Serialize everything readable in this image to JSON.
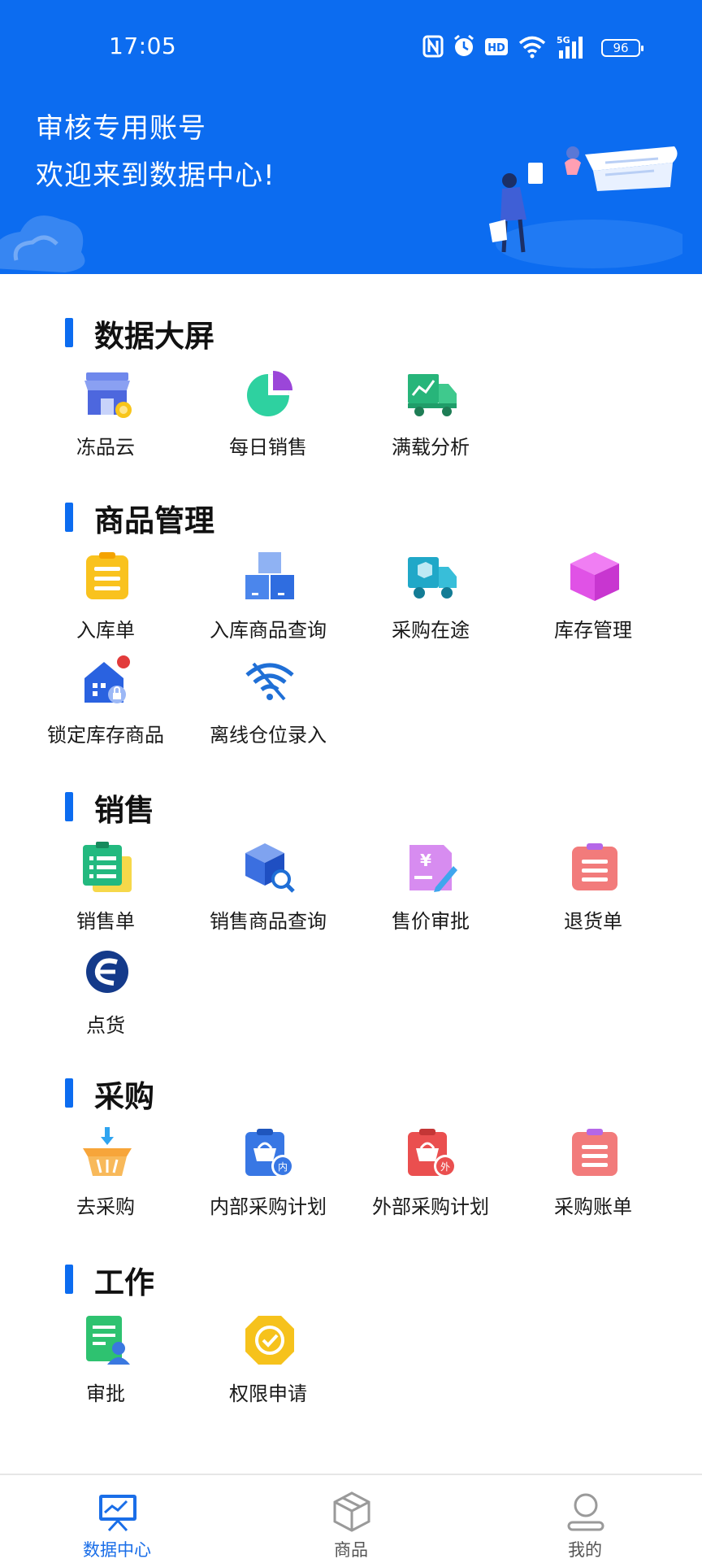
{
  "status_bar": {
    "time": "17:05",
    "battery": "96"
  },
  "header": {
    "line1": "审核专用账号",
    "line2": "欢迎来到数据中心!"
  },
  "sections": [
    {
      "title": "数据大屏",
      "items": [
        {
          "label": "冻品云",
          "icon": "store-icon"
        },
        {
          "label": "每日销售",
          "icon": "pie-chart-icon"
        },
        {
          "label": "满载分析",
          "icon": "truck-chart-icon"
        }
      ]
    },
    {
      "title": "商品管理",
      "items": [
        {
          "label": "入库单",
          "icon": "clipboard-icon"
        },
        {
          "label": "入库商品查询",
          "icon": "boxes-icon"
        },
        {
          "label": "采购在途",
          "icon": "delivery-truck-icon"
        },
        {
          "label": "库存管理",
          "icon": "cube-icon"
        },
        {
          "label": "锁定库存商品",
          "icon": "locked-warehouse-icon"
        },
        {
          "label": "离线仓位录入",
          "icon": "wifi-off-icon"
        }
      ]
    },
    {
      "title": "销售",
      "items": [
        {
          "label": "销售单",
          "icon": "sales-list-icon"
        },
        {
          "label": "销售商品查询",
          "icon": "box-search-icon"
        },
        {
          "label": "售价审批",
          "icon": "price-edit-icon"
        },
        {
          "label": "退货单",
          "icon": "return-list-icon"
        },
        {
          "label": "点货",
          "icon": "count-goods-icon"
        }
      ]
    },
    {
      "title": "采购",
      "items": [
        {
          "label": "去采购",
          "icon": "basket-icon"
        },
        {
          "label": "内部采购计划",
          "icon": "internal-plan-icon"
        },
        {
          "label": "外部采购计划",
          "icon": "external-plan-icon"
        },
        {
          "label": "采购账单",
          "icon": "bill-icon"
        }
      ]
    },
    {
      "title": "工作",
      "items": [
        {
          "label": "审批",
          "icon": "approval-doc-icon"
        },
        {
          "label": "权限申请",
          "icon": "permission-badge-icon"
        }
      ]
    }
  ],
  "tabs": [
    {
      "label": "数据中心",
      "icon": "dashboard-icon",
      "active": true
    },
    {
      "label": "商品",
      "icon": "package-icon",
      "active": false
    },
    {
      "label": "我的",
      "icon": "user-icon",
      "active": false
    }
  ],
  "colors": {
    "primary": "#0c6cf0",
    "tab_active": "#1a6ee8"
  }
}
